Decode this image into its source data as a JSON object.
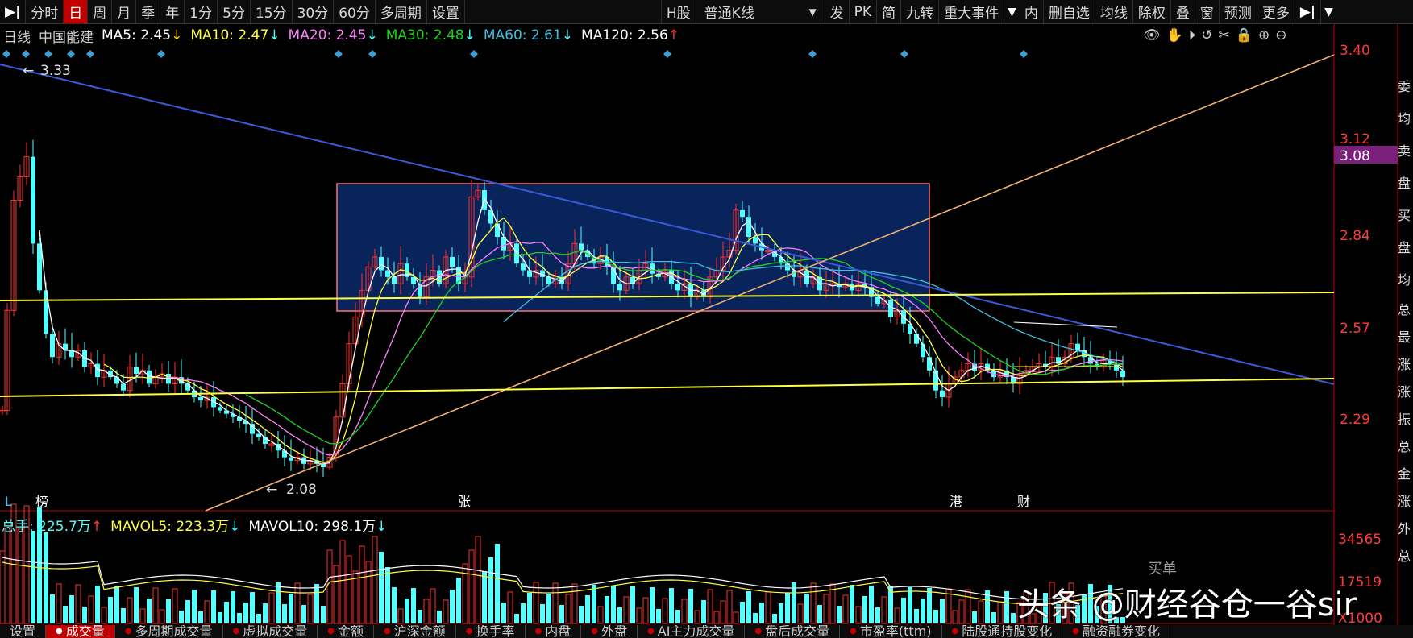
{
  "toolbar": {
    "first_icon": "▶|",
    "items": [
      "分时",
      "日",
      "周",
      "月",
      "季",
      "年",
      "1分",
      "5分",
      "15分",
      "30分",
      "60分",
      "多周期",
      "设置"
    ],
    "active_index": 1,
    "market": "H股",
    "kline_type": "普通K线",
    "right_items": [
      "发",
      "PK",
      "简",
      "九转",
      "重大事件",
      "内",
      "删自选",
      "均线",
      "除权",
      "叠",
      "窗",
      "预测",
      "更多"
    ],
    "end_icon": "▶|"
  },
  "legend": {
    "period": "日线",
    "name": "中国能建",
    "ma5": "MA5: 2.45",
    "ma5_arrow": "↓",
    "ma10": "MA10: 2.47",
    "ma10_arrow": "↓",
    "ma20": "MA20: 2.45",
    "ma20_arrow": "↓",
    "ma30": "MA30: 2.48",
    "ma30_arrow": "↓",
    "ma60": "MA60: 2.61",
    "ma60_arrow": "↓",
    "ma120": "MA120: 2.56",
    "ma120_arrow": "↑"
  },
  "price_axis": {
    "ticks": [
      "3.40",
      "3.12",
      "2.84",
      "2.57",
      "2.29"
    ],
    "current": "3.08"
  },
  "annotations": {
    "high": "3.33",
    "low": "2.08",
    "marker_l": "L",
    "marker_bang": "榜",
    "marker_zhang": "张",
    "marker_gang": "港",
    "marker_cai": "财"
  },
  "volume": {
    "total_label": "总手: 225.7万",
    "total_arrow": "↑",
    "mavol5": "MAVOL5: 223.3万",
    "mavol5_arrow": "↓",
    "mavol10": "MAVOL10: 298.1万",
    "mavol10_arrow": "↓",
    "axis_ticks": [
      "34565",
      "17519",
      "X1000"
    ],
    "buy_label": "买单"
  },
  "right_panel": [
    "委",
    "均",
    "卖",
    "盘",
    "买",
    "盘",
    "均",
    "总",
    "最",
    "涨",
    "涨",
    "振",
    "总",
    "金",
    "涨",
    "外",
    "总"
  ],
  "bottom_tabs": [
    "设置",
    "成交量",
    "多周期成交量",
    "虚拟成交量",
    "金额",
    "沪深金额",
    "换手率",
    "内盘",
    "外盘",
    "AI主力成交量",
    "盘后成交量",
    "市盈率(ttm)",
    "陆股通持股变化",
    "融资融券变化"
  ],
  "bottom_active": 1,
  "watermark": "头条 @财经谷仓一谷sir",
  "colors": {
    "up": "#ff3030",
    "down": "#54ffff",
    "ma5": "#ffffff",
    "ma10": "#ffff40",
    "ma20": "#ff80ff",
    "ma30": "#20d020",
    "ma60": "#40c0e0",
    "accent": "#c00000"
  }
}
